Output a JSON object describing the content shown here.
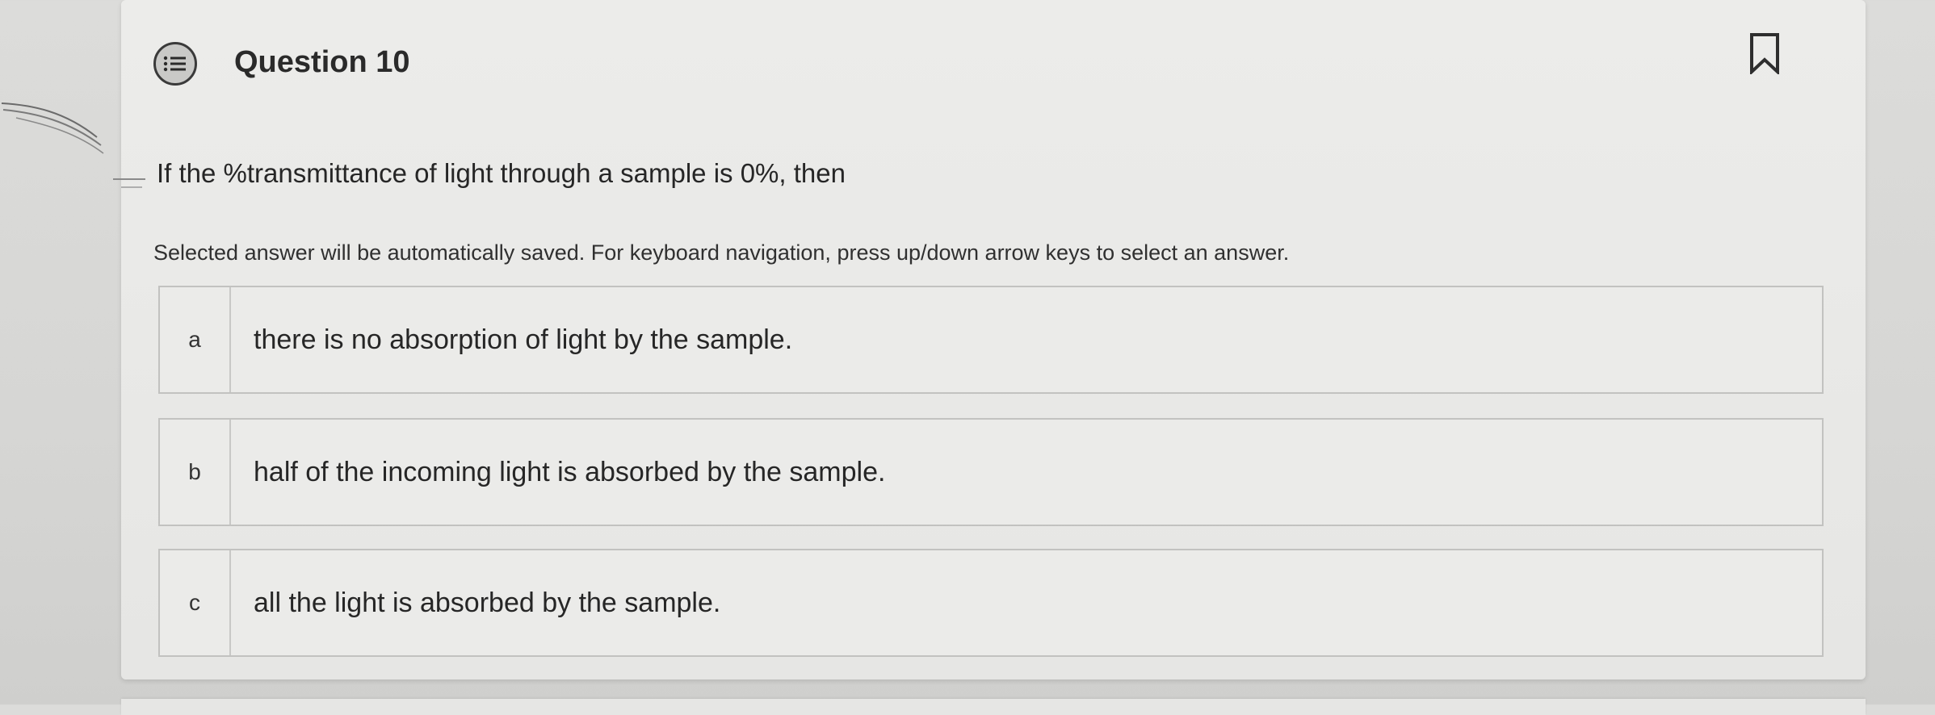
{
  "question": {
    "title": "Question 10",
    "text": "If the %transmittance of light through a sample is 0%, then",
    "instructions": "Selected answer will be automatically saved. For keyboard navigation, press up/down arrow keys to select an answer."
  },
  "options": [
    {
      "letter": "a",
      "text": "there is no absorption of light by the sample."
    },
    {
      "letter": "b",
      "text": "half of the incoming light is absorbed by the sample."
    },
    {
      "letter": "c",
      "text": "all the light is absorbed by the sample."
    }
  ],
  "icons": {
    "question_icon": "question-list-icon",
    "bookmark": "bookmark-icon"
  },
  "colors": {
    "page_background": "#dcdcda",
    "card_background": "#ebebe9",
    "text": "#262626",
    "border": "#c2c2c0"
  }
}
